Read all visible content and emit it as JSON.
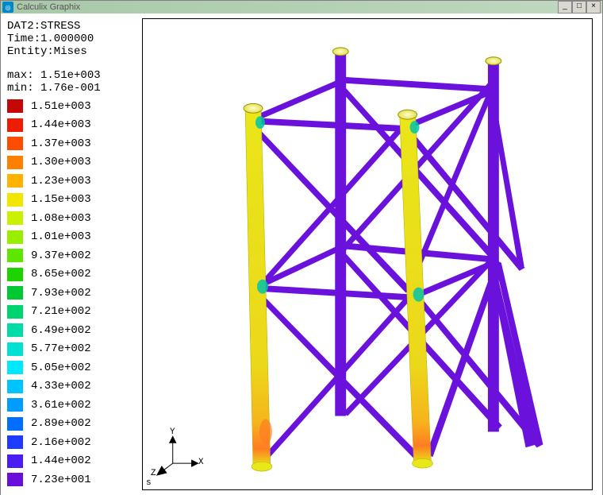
{
  "window": {
    "title": "Calculix Graphix"
  },
  "info": {
    "dataset": "DAT2:STRESS",
    "time": "Time:1.000000",
    "entity": "Entity:Mises",
    "max": "max: 1.51e+003",
    "min": "min: 1.76e-001"
  },
  "legend": {
    "items": [
      {
        "color": "#c40808",
        "label": "1.51e+003"
      },
      {
        "color": "#ef1c00",
        "label": "1.44e+003"
      },
      {
        "color": "#ff4d00",
        "label": "1.37e+003"
      },
      {
        "color": "#ff8000",
        "label": "1.30e+003"
      },
      {
        "color": "#ffb300",
        "label": "1.23e+003"
      },
      {
        "color": "#f2e600",
        "label": "1.15e+003"
      },
      {
        "color": "#c9f100",
        "label": "1.08e+003"
      },
      {
        "color": "#99ee00",
        "label": "1.01e+003"
      },
      {
        "color": "#5ce600",
        "label": "9.37e+002"
      },
      {
        "color": "#1ed400",
        "label": "8.65e+002"
      },
      {
        "color": "#00c934",
        "label": "7.93e+002"
      },
      {
        "color": "#00d471",
        "label": "7.21e+002"
      },
      {
        "color": "#00dca6",
        "label": "6.49e+002"
      },
      {
        "color": "#00e1d4",
        "label": "5.77e+002"
      },
      {
        "color": "#00e8ff",
        "label": "5.05e+002"
      },
      {
        "color": "#00c4ff",
        "label": "4.33e+002"
      },
      {
        "color": "#009cff",
        "label": "3.61e+002"
      },
      {
        "color": "#006eff",
        "label": "2.89e+002"
      },
      {
        "color": "#1d3cff",
        "label": "2.16e+002"
      },
      {
        "color": "#4b1df2",
        "label": "1.44e+002"
      },
      {
        "color": "#6a0edc",
        "label": "7.23e+001"
      }
    ]
  },
  "axes": {
    "x": "X",
    "y": "Y",
    "z": "Z",
    "s": "s"
  },
  "colors": {
    "strut_low": "#6a12dc",
    "leg_high": "#e9e619",
    "joint": "#00c4a8",
    "hot": "#ff7c22"
  }
}
